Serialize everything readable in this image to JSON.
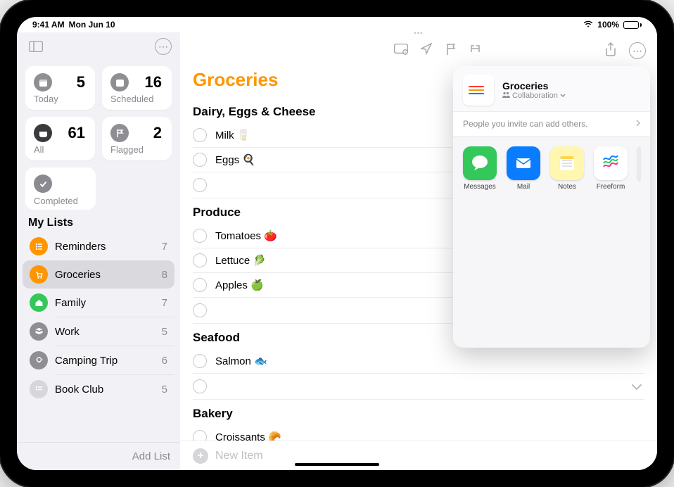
{
  "statusbar": {
    "time": "9:41 AM",
    "date": "Mon Jun 10",
    "battery": "100%"
  },
  "sidebar": {
    "smart": {
      "today": {
        "label": "Today",
        "count": "5"
      },
      "scheduled": {
        "label": "Scheduled",
        "count": "16"
      },
      "all": {
        "label": "All",
        "count": "61"
      },
      "flagged": {
        "label": "Flagged",
        "count": "2"
      },
      "completed": {
        "label": "Completed"
      }
    },
    "mylists_title": "My Lists",
    "lists": [
      {
        "name": "Reminders",
        "count": "7",
        "color": "#ff9500"
      },
      {
        "name": "Groceries",
        "count": "8",
        "color": "#ff9500",
        "selected": true
      },
      {
        "name": "Family",
        "count": "7",
        "color": "#34c759"
      },
      {
        "name": "Work",
        "count": "5",
        "color": "#8e8e93"
      },
      {
        "name": "Camping Trip",
        "count": "6",
        "color": "#8e8e93"
      },
      {
        "name": "Book Club",
        "count": "5",
        "color": "#d7d7db"
      }
    ],
    "add_list_label": "Add List"
  },
  "main": {
    "title": "Groceries",
    "sections": [
      {
        "title": "Dairy, Eggs & Cheese",
        "items": [
          "Milk 🥛",
          "Eggs 🍳"
        ]
      },
      {
        "title": "Produce",
        "items": [
          "Tomatoes 🍅",
          "Lettuce 🥬",
          "Apples 🍏"
        ]
      },
      {
        "title": "Seafood",
        "items": [
          "Salmon 🐟"
        ]
      },
      {
        "title": "Bakery",
        "items": [
          "Croissants 🥐"
        ]
      }
    ],
    "new_item_placeholder": "New Item"
  },
  "share": {
    "title": "Groceries",
    "subtitle": "Collaboration",
    "info": "People you invite can add others.",
    "apps": [
      {
        "label": "Messages",
        "bg": "#34c759"
      },
      {
        "label": "Mail",
        "bg": "#0a7cff"
      },
      {
        "label": "Notes",
        "bg": "#fff6b0"
      },
      {
        "label": "Freeform",
        "bg": "#ffffff"
      }
    ]
  }
}
